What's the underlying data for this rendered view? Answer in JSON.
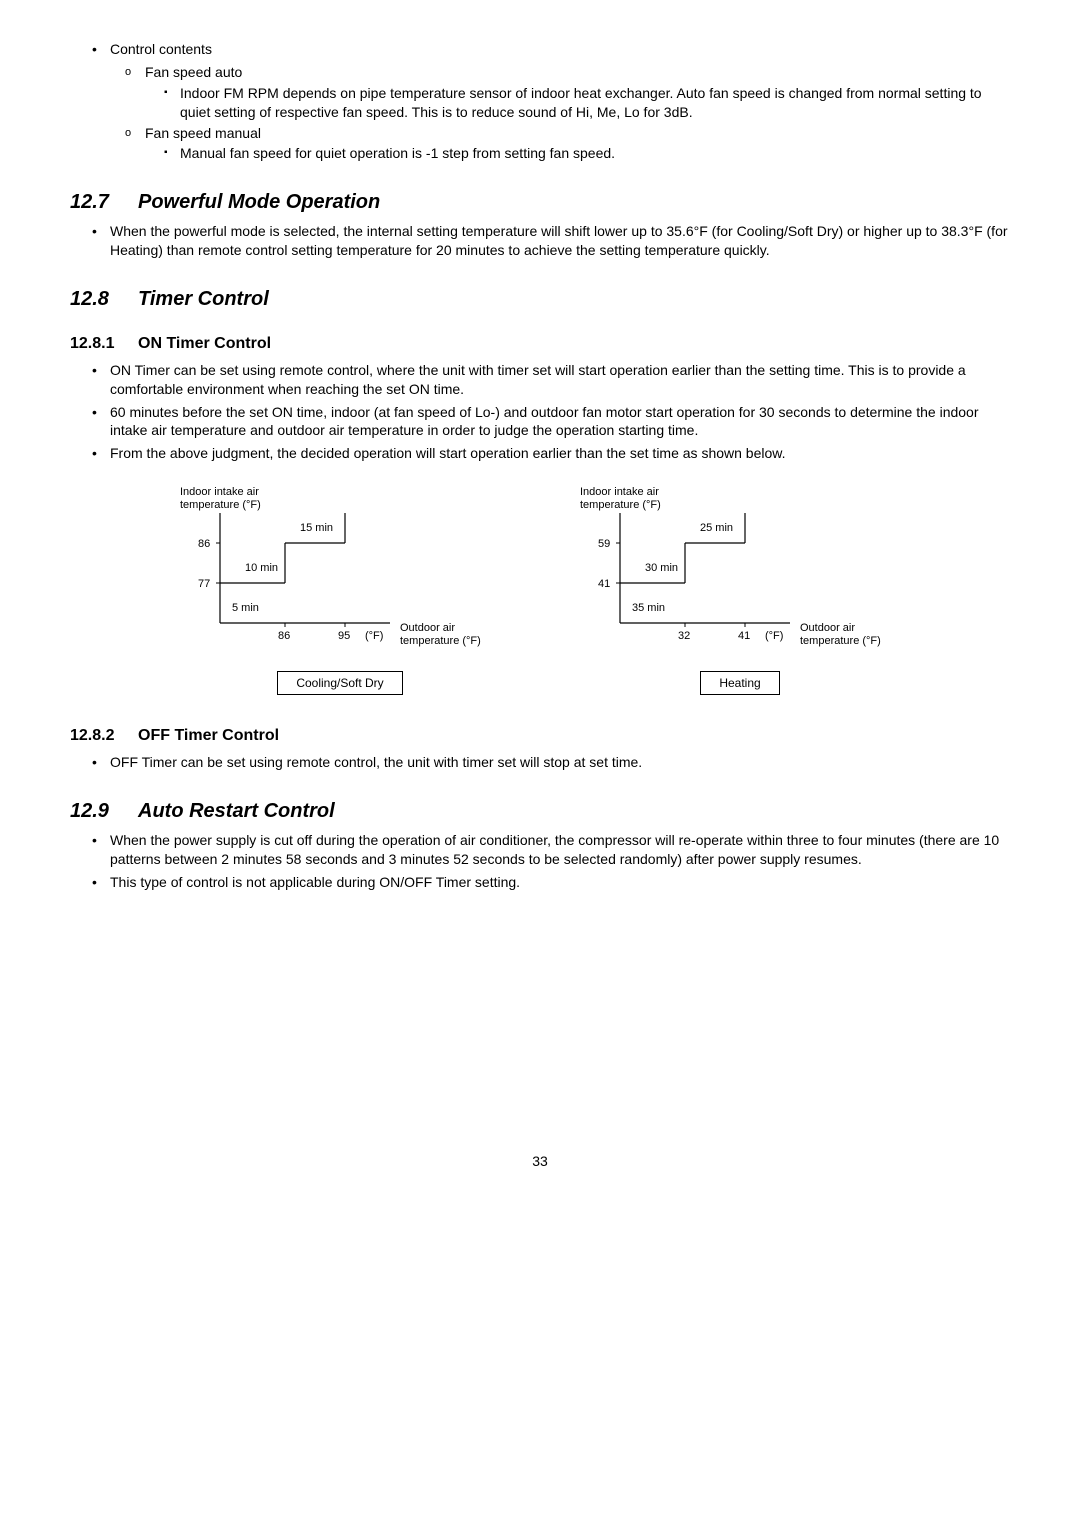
{
  "control": {
    "title": "Control contents",
    "fanAuto": "Fan speed auto",
    "fanAutoDetail": "Indoor FM RPM depends on pipe temperature sensor of indoor heat exchanger. Auto fan speed is changed from normal setting to quiet setting of respective fan speed. This is to reduce sound of Hi, Me, Lo for 3dB.",
    "fanManual": "Fan speed manual",
    "fanManualDetail": "Manual fan speed for quiet operation is -1 step from setting fan speed."
  },
  "s127": {
    "num": "12.7",
    "title": "Powerful Mode Operation",
    "p1": "When the powerful mode is selected, the internal setting temperature will shift lower up to 35.6°F (for Cooling/Soft Dry) or higher up to 38.3°F (for Heating) than remote control setting temperature for 20 minutes to achieve the setting temperature quickly."
  },
  "s128": {
    "num": "12.8",
    "title": "Timer Control",
    "s1num": "12.8.1",
    "s1title": "ON Timer Control",
    "s1p1": "ON Timer can be set using remote control, where the unit with timer set will start operation earlier than the setting time. This is to provide a comfortable environment when reaching the set ON time.",
    "s1p2": "60 minutes before the set ON time, indoor (at fan speed of Lo-) and outdoor fan motor start operation for 30 seconds to determine the indoor intake air temperature and outdoor air temperature in order to judge the operation starting time.",
    "s1p3": "From the above judgment, the decided operation will start operation earlier than the set time as shown below.",
    "s2num": "12.8.2",
    "s2title": "OFF Timer Control",
    "s2p1": "OFF Timer can be set using remote control, the unit with timer set will stop at set time."
  },
  "s129": {
    "num": "12.9",
    "title": "Auto Restart Control",
    "p1": "When the power supply is cut off during the operation of air conditioner, the compressor will re-operate within three to four minutes (there are 10 patterns between 2 minutes 58 seconds and 3 minutes 52 seconds to be selected randomly) after power supply resumes.",
    "p2": "This type of control is not applicable during ON/OFF Timer setting."
  },
  "chart_data": [
    {
      "type": "step",
      "title": "Cooling/Soft Dry",
      "y_axis_label": "Indoor intake air\ntemperature (°F)",
      "x_axis_label": "Outdoor air\ntemperature (°F)",
      "y_ticks": [
        77,
        86
      ],
      "x_ticks": [
        86,
        95
      ],
      "x_unit": "(°F)",
      "regions": [
        {
          "label": "5 min",
          "y_range": "<77",
          "x_range": "<86"
        },
        {
          "label": "10 min",
          "y_range": "77-86",
          "x_range": "<86"
        },
        {
          "label": "15 min",
          "y_range": ">86",
          "x_range": "86-95"
        }
      ]
    },
    {
      "type": "step",
      "title": "Heating",
      "y_axis_label": "Indoor intake air\ntemperature (°F)",
      "x_axis_label": "Outdoor air\ntemperature (°F)",
      "y_ticks": [
        41,
        59
      ],
      "x_ticks": [
        32,
        41
      ],
      "x_unit": "(°F)",
      "regions": [
        {
          "label": "35 min",
          "y_range": "<41",
          "x_range": "<32"
        },
        {
          "label": "30 min",
          "y_range": "41-59",
          "x_range": "32-41"
        },
        {
          "label": "25 min",
          "y_range": ">59",
          "x_range": ">41"
        }
      ]
    }
  ],
  "chart_text": {
    "intake1": "Indoor intake air",
    "intake2": "temperature (°F)",
    "outdoor1": "Outdoor air",
    "outdoor2": "temperature (°F)",
    "unitF": "(°F)",
    "c1": {
      "y1": "86",
      "y2": "77",
      "x1": "86",
      "x2": "95",
      "r1": "5 min",
      "r2": "10 min",
      "r3": "15 min",
      "box": "Cooling/Soft Dry"
    },
    "c2": {
      "y1": "59",
      "y2": "41",
      "x1": "32",
      "x2": "41",
      "r1": "35 min",
      "r2": "30 min",
      "r3": "25 min",
      "box": "Heating"
    }
  },
  "pageNum": "33"
}
